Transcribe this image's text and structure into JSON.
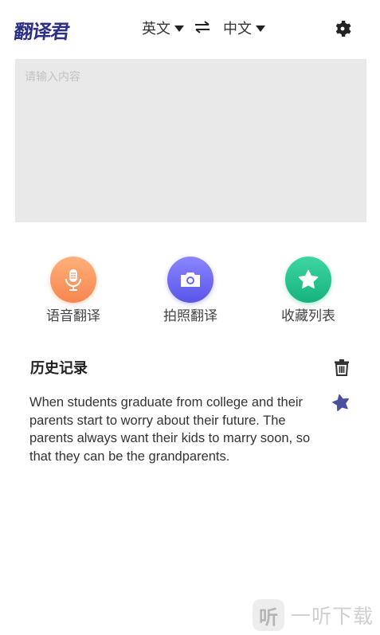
{
  "app": {
    "logo_text": "翻译君"
  },
  "header": {
    "source_lang": "英文",
    "target_lang": "中文",
    "swap_icon": "swap-arrows-icon",
    "settings_icon": "gear-icon"
  },
  "input": {
    "placeholder": "请输入内容",
    "value": ""
  },
  "actions": [
    {
      "label": "语音翻译",
      "icon": "microphone-icon",
      "color": "#f7864f"
    },
    {
      "label": "拍照翻译",
      "icon": "camera-icon",
      "color": "#5a54e8"
    },
    {
      "label": "收藏列表",
      "icon": "star-icon",
      "color": "#16b27d"
    }
  ],
  "history": {
    "title": "历史记录",
    "delete_icon": "trash-icon",
    "items": [
      {
        "text": "When students graduate from college and their parents start to worry about their future. The parents always want their kids to marry soon, so that they can be the grandparents.",
        "favorited": true
      }
    ]
  },
  "watermark": {
    "icon_text": "听",
    "text": "一听下载"
  },
  "colors": {
    "logo": "#2c2f86",
    "input_bg": "#e9e9e9",
    "star": "#4a4f9e"
  }
}
